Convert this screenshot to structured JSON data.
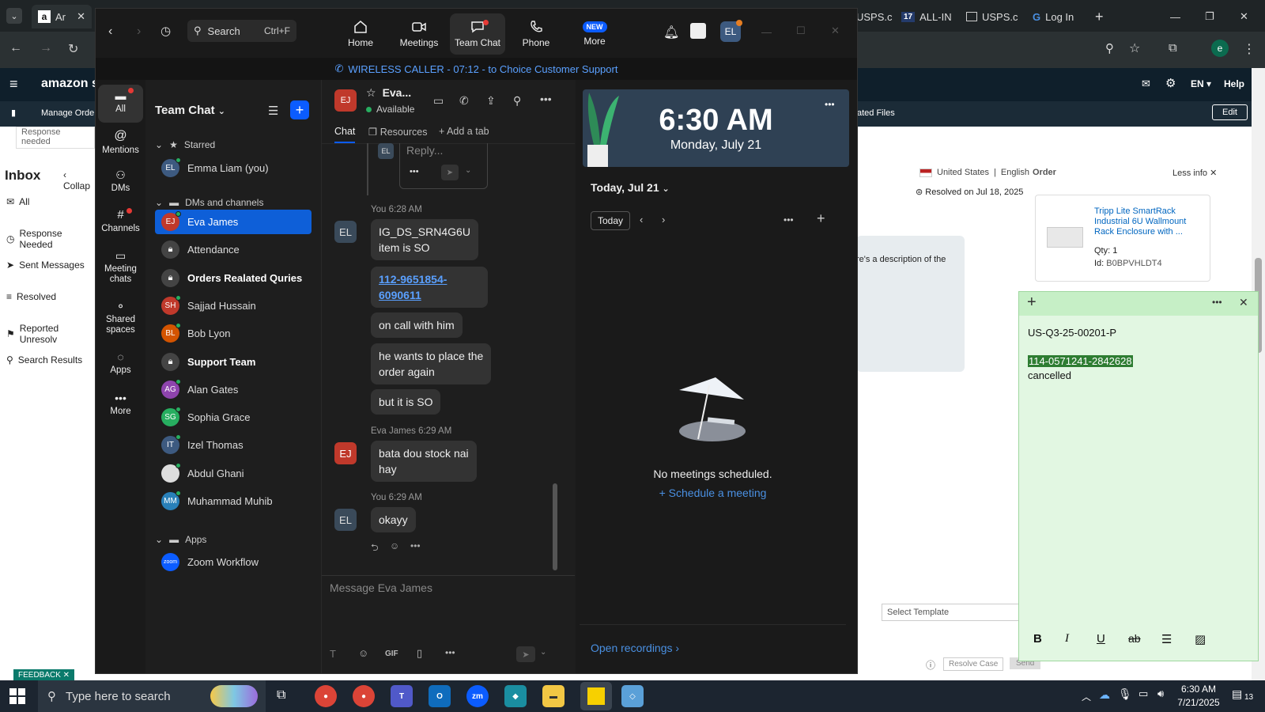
{
  "browser": {
    "tabs": [
      {
        "label": "Ar"
      },
      {
        "label": "USPS.c"
      },
      {
        "label": "ALL-IN"
      },
      {
        "label": "USPS.c"
      },
      {
        "label": "Log In"
      }
    ],
    "profile_initial": "e"
  },
  "amazon": {
    "logo": "amazon sel",
    "lang": "EN",
    "help": "Help",
    "manage_orders": "Manage Order",
    "related_files": "ated Files",
    "edit": "Edit",
    "response_needed_banner": "Response needed",
    "inbox_title": "Inbox",
    "collapse": "Collap",
    "nav": [
      "All",
      "Response Needed",
      "Sent Messages",
      "Resolved",
      "Reported Unresolv",
      "Search Results"
    ],
    "country": "United States",
    "language": "English",
    "resolved_text": "Resolved on Jul 18, 2025",
    "message_snippet": "re's a description of the",
    "order_header": "Order",
    "less_info": "Less info",
    "product_title": "Tripp Lite SmartRack Industrial 6U Wallmount Rack Enclosure with ...",
    "qty_label": "Qty:",
    "qty": "1",
    "id_label": "Id:",
    "product_id": "B0BPVHLDT4",
    "select_template": "Select Template",
    "resolve_case": "Resolve Case",
    "send": "Send",
    "feedback": "FEEDBACK"
  },
  "zoom": {
    "search_label": "Search",
    "search_shortcut": "Ctrl+F",
    "nav": [
      {
        "label": "Home"
      },
      {
        "label": "Meetings"
      },
      {
        "label": "Team Chat"
      },
      {
        "label": "Phone"
      },
      {
        "label": "More",
        "badge": "NEW"
      }
    ],
    "profile_initials": "EL",
    "call_banner": "WIRELESS CALLER - 07:12 - to Choice Customer Support",
    "rail": [
      "All",
      "Mentions",
      "DMs",
      "Channels",
      "Meeting chats",
      "Shared spaces",
      "Apps",
      "More"
    ],
    "chat_list": {
      "title": "Team Chat",
      "sections": {
        "starred": "Starred",
        "dms": "DMs and channels",
        "apps": "Apps"
      },
      "starred": [
        {
          "initials": "EL",
          "name": "Emma Liam (you)",
          "color": "#3d5a80"
        }
      ],
      "items": [
        {
          "initials": "EJ",
          "name": "Eva James",
          "color": "#c0392b",
          "selected": true
        },
        {
          "initials": "",
          "name": "Attendance",
          "color": "#444",
          "lock": true
        },
        {
          "initials": "",
          "name": "Orders Realated Quries",
          "color": "#444",
          "lock": true,
          "bold": true
        },
        {
          "initials": "SH",
          "name": "Sajjad Hussain",
          "color": "#c0392b"
        },
        {
          "initials": "BL",
          "name": "Bob Lyon",
          "color": "#d35400"
        },
        {
          "initials": "",
          "name": "Support Team",
          "color": "#444",
          "lock": true,
          "bold": true
        },
        {
          "initials": "AG",
          "name": "Alan Gates",
          "color": "#8e44ad"
        },
        {
          "initials": "SG",
          "name": "Sophia Grace",
          "color": "#27ae60"
        },
        {
          "initials": "IT",
          "name": "Izel Thomas",
          "color": "#3d5a80"
        },
        {
          "initials": "",
          "name": "Abdul Ghani",
          "color": "#ddd"
        },
        {
          "initials": "MM",
          "name": "Muhammad Muhib",
          "color": "#2980b9"
        }
      ],
      "apps": [
        {
          "initials": "zoom",
          "name": "Zoom Workflow",
          "color": "#0b5cff"
        }
      ]
    },
    "conversation": {
      "contact_initials": "EJ",
      "contact_name": "Eva...",
      "status": "Available",
      "tabs": [
        "Chat",
        "Resources",
        "Add a tab"
      ],
      "reply_placeholder": "Reply...",
      "messages": [
        {
          "stamp": "You 6:28 AM",
          "lines": [
            "IG_DS_SRN4G6U",
            "item is SO"
          ]
        },
        {
          "link_parts": [
            "112-9651854",
            "-",
            "6090",
            "611"
          ]
        },
        {
          "lines": [
            "on call with him"
          ]
        },
        {
          "lines": [
            "he wants to place the",
            "order again"
          ]
        },
        {
          "lines": [
            "but it is SO"
          ]
        },
        {
          "stamp": "Eva James 6:29 AM",
          "lines": [
            "bata dou stock nai",
            "hay"
          ]
        },
        {
          "stamp": "You 6:29 AM",
          "lines": [
            "okayy"
          ]
        }
      ],
      "composer_placeholder": "Message Eva James",
      "gif": "GIF"
    },
    "calendar": {
      "time": "6:30 AM",
      "date": "Monday, July 21",
      "today_heading": "Today, Jul 21",
      "today_btn": "Today",
      "empty": "No meetings scheduled.",
      "schedule": "Schedule a meeting",
      "open_recordings": "Open recordings"
    }
  },
  "sticky_note": {
    "line1": "US-Q3-25-00201-P",
    "highlight": "114-0571241-2842628",
    "line3": "cancelled"
  },
  "taskbar": {
    "search_placeholder": "Type here to search",
    "time": "6:30 AM",
    "date": "7/21/2025",
    "notif_count": "13"
  },
  "colors": {
    "zoom_accent": "#0b5cff",
    "selected_chat": "#0e5fd8",
    "sticky_bg": "#e2f7e2",
    "highlight": "#2e7d32"
  }
}
